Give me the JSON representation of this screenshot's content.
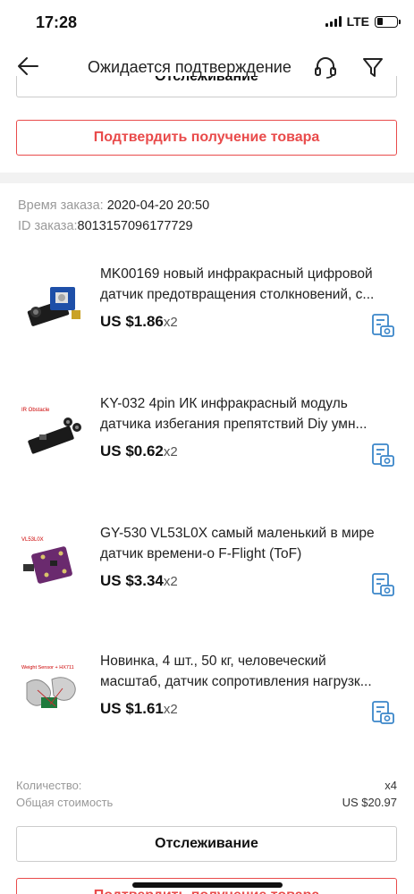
{
  "status": {
    "time": "17:28",
    "network": "LTE"
  },
  "header": {
    "title": "Ожидается подтверждение"
  },
  "buttons": {
    "tracking": "Отслеживание",
    "confirm": "Подтвердить получение товара"
  },
  "order": {
    "time_label": "Время заказа:",
    "time_value": "2020-04-20 20:50",
    "id_label": "ID заказа:",
    "id_value": "8013157096177729"
  },
  "items": [
    {
      "title_line1": "MK00169 новый инфракрасный цифровой",
      "title_line2": "датчик предотвращения столкновений, с...",
      "price": "US $1.86",
      "qty": "x2",
      "thumb_label": ""
    },
    {
      "title_line1": "KY-032 4pin ИК инфракрасный модуль",
      "title_line2": "датчика избегания препятствий Diy умн...",
      "price": "US $0.62",
      "qty": "x2",
      "thumb_label": "IR Obstacle"
    },
    {
      "title_line1": "GY-530 VL53L0X самый маленький в мире",
      "title_line2": "датчик времени-о F-Flight (ToF)",
      "price": "US $3.34",
      "qty": "x2",
      "thumb_label": "VL53L0X"
    },
    {
      "title_line1": "Новинка, 4 шт., 50 кг, человеческий",
      "title_line2": "масштаб, датчик сопротивления нагрузк...",
      "price": "US $1.61",
      "qty": "x2",
      "thumb_label": "Weight Sensor + HX711"
    }
  ],
  "summary": {
    "quantity_label": "Количество:",
    "quantity_value": "x4",
    "total_label": "Общая стоимость",
    "total_value": "US $20.97"
  },
  "colors": {
    "accent": "#e94b4b",
    "icon_blue": "#3b86c9",
    "divider": "#f2f2f2"
  },
  "icons": [
    "back-arrow-icon",
    "headset-icon",
    "filter-icon",
    "photo-review-icon"
  ]
}
